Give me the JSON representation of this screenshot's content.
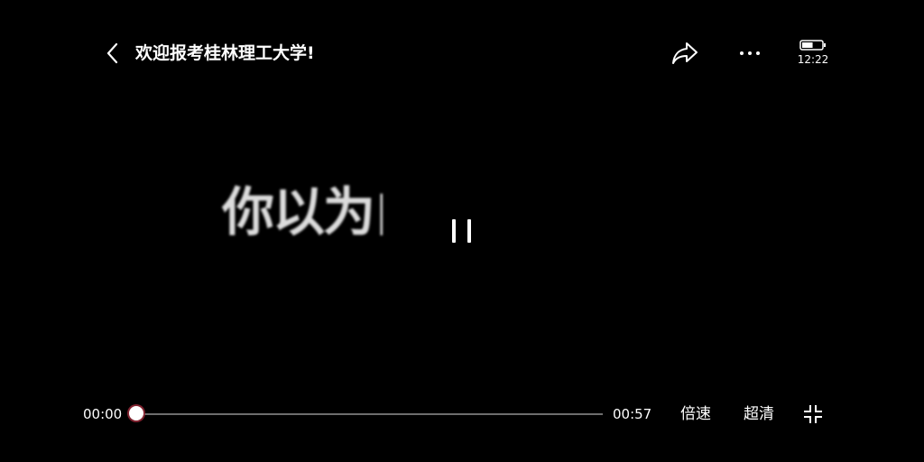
{
  "header": {
    "title": "欢迎报考桂林理工大学!",
    "back_icon": "chevron-left-icon",
    "share_icon": "share-arrow-icon",
    "more_icon": "more-horizontal-icon"
  },
  "status": {
    "battery_icon": "battery-icon",
    "battery_level": 0.55,
    "time": "12:22"
  },
  "video": {
    "caption": "你以为白",
    "state": "playing",
    "pause_icon": "pause-icon"
  },
  "controls": {
    "current_time": "00:00",
    "total_time": "00:57",
    "progress": 0.0,
    "speed_label": "倍速",
    "quality_label": "超清",
    "exit_fullscreen_icon": "exit-fullscreen-icon"
  },
  "colors": {
    "background": "#000000",
    "text": "#ffffff",
    "track": "#6e6e6e",
    "thumb_ring": "#962837"
  }
}
